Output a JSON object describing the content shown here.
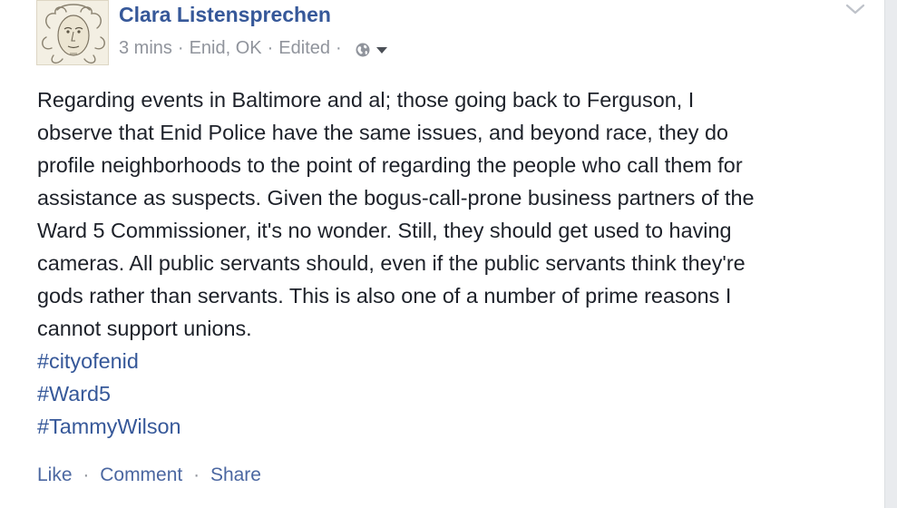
{
  "post": {
    "author": "Clara Listensprechen",
    "time": "3 mins",
    "location": "Enid, OK",
    "edited": "Edited",
    "separator": "·",
    "privacy_icon": "globe-icon",
    "audience_icon": "caret-down-icon",
    "options_icon": "chevron-down-icon",
    "body_lines": [
      "Regarding events in Baltimore and al; those going back to Ferguson, I",
      "observe that Enid Police have the same issues, and beyond race, they do",
      "profile neighborhoods to the point of regarding the people who call them for",
      "assistance as suspects. Given the bogus-call-prone business partners of the",
      "Ward 5 Commissioner, it's no wonder. Still, they should get used to having",
      "cameras. All public servants should, even if the public servants think they're",
      "gods rather than servants. This is also one of a number of prime reasons I",
      "cannot support unions."
    ],
    "hashtags": [
      "#cityofenid",
      "#Ward5",
      "#TammyWilson"
    ]
  },
  "actions": {
    "like": "Like",
    "comment": "Comment",
    "share": "Share",
    "separator": "·"
  },
  "colors": {
    "link": "#365899",
    "meta": "#90949c",
    "text": "#1d2129",
    "action": "#4b67a1"
  }
}
